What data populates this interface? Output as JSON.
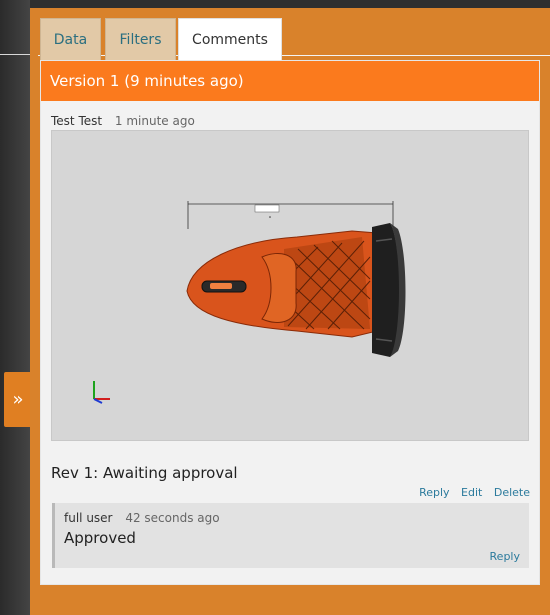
{
  "tabs": [
    {
      "label": "Data"
    },
    {
      "label": "Filters"
    },
    {
      "label": "Comments"
    }
  ],
  "expand_icon": "»",
  "version_header": "Version 1 (9 minutes ago)",
  "comment": {
    "author": "Test Test",
    "time": "1 minute ago",
    "attachment_icon": "3d-model-snapshot"
  },
  "revision_status": "Rev 1: Awaiting approval",
  "actions": {
    "reply": "Reply",
    "edit": "Edit",
    "delete": "Delete"
  },
  "reply": {
    "author": "full user",
    "time": "42 seconds ago",
    "text": "Approved",
    "reply_label": "Reply"
  },
  "colors": {
    "panel": "#d9822b",
    "header": "#fb7a1d",
    "link": "#2b7a9c",
    "tab_active": "#ffffff",
    "tab_inactive": "#e2c9a7"
  }
}
